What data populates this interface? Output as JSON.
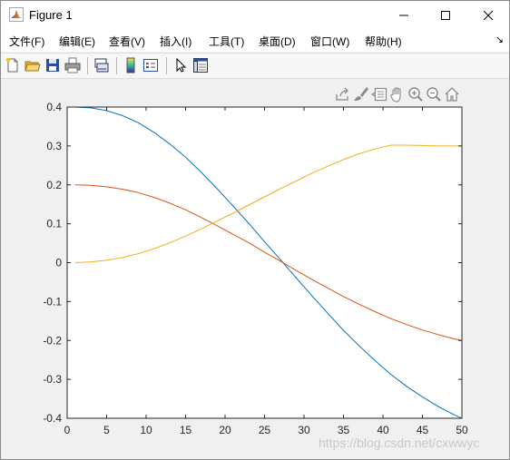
{
  "window": {
    "title": "Figure 1"
  },
  "menu": {
    "items": [
      "文件(F)",
      "编辑(E)",
      "查看(V)",
      "插入(I)",
      "工具(T)",
      "桌面(D)",
      "窗口(W)",
      "帮助(H)"
    ],
    "more_icon": "return-arrow-icon"
  },
  "toolbar": {
    "icons": [
      "new-figure-icon",
      "open-file-icon",
      "save-icon",
      "print-icon",
      "link-plot-icon",
      "insert-colorbar-icon",
      "insert-legend-icon",
      "edit-plot-arrow-icon",
      "property-inspector-icon"
    ]
  },
  "axes_toolbar": {
    "icons": [
      "export-icon",
      "brush-icon",
      "data-tips-icon",
      "pan-hand-icon",
      "zoom-in-icon",
      "zoom-out-icon",
      "home-icon"
    ]
  },
  "chart_data": {
    "type": "line",
    "title": "",
    "xlabel": "",
    "ylabel": "",
    "xlim": [
      0,
      50
    ],
    "ylim": [
      -0.4,
      0.4
    ],
    "xticks": [
      0,
      5,
      10,
      15,
      20,
      25,
      30,
      35,
      40,
      45,
      50
    ],
    "xtick_labels": [
      "0",
      "5",
      "10",
      "15",
      "20",
      "25",
      "30",
      "35",
      "40",
      "45",
      "50"
    ],
    "yticks": [
      0.4,
      0.3,
      0.2,
      0.1,
      0,
      -0.1,
      -0.2,
      -0.3,
      -0.4
    ],
    "ytick_labels": [
      "0.4",
      "0.3",
      "0.2",
      "0.1",
      "0",
      "-0.1",
      "-0.2",
      "-0.3",
      "-0.4"
    ],
    "grid": false,
    "x": [
      1,
      3,
      5,
      7,
      9,
      11,
      13,
      15,
      17,
      19,
      21,
      23,
      25,
      27,
      29,
      31,
      33,
      35,
      37,
      39,
      41,
      43,
      45,
      47,
      49,
      50
    ],
    "series": [
      {
        "color": "#0072bd",
        "values": [
          0.4,
          0.398,
          0.391,
          0.378,
          0.36,
          0.335,
          0.305,
          0.271,
          0.232,
          0.19,
          0.146,
          0.101,
          0.054,
          0.008,
          -0.039,
          -0.085,
          -0.13,
          -0.174,
          -0.214,
          -0.252,
          -0.287,
          -0.318,
          -0.345,
          -0.37,
          -0.391,
          -0.4
        ]
      },
      {
        "color": "#d95319",
        "values": [
          0.2,
          0.199,
          0.195,
          0.189,
          0.18,
          0.168,
          0.153,
          0.136,
          0.116,
          0.095,
          0.073,
          0.051,
          0.027,
          0.004,
          -0.02,
          -0.043,
          -0.065,
          -0.087,
          -0.107,
          -0.126,
          -0.144,
          -0.159,
          -0.173,
          -0.185,
          -0.196,
          -0.2
        ]
      },
      {
        "color": "#edb120",
        "values": [
          0.0,
          0.002,
          0.006,
          0.013,
          0.023,
          0.036,
          0.051,
          0.068,
          0.087,
          0.107,
          0.127,
          0.148,
          0.169,
          0.19,
          0.21,
          0.23,
          0.248,
          0.265,
          0.28,
          0.292,
          0.302,
          0.302,
          0.301,
          0.3,
          0.3,
          0.3
        ]
      }
    ]
  },
  "watermark": "https://blog.csdn.net/cxwwyc"
}
